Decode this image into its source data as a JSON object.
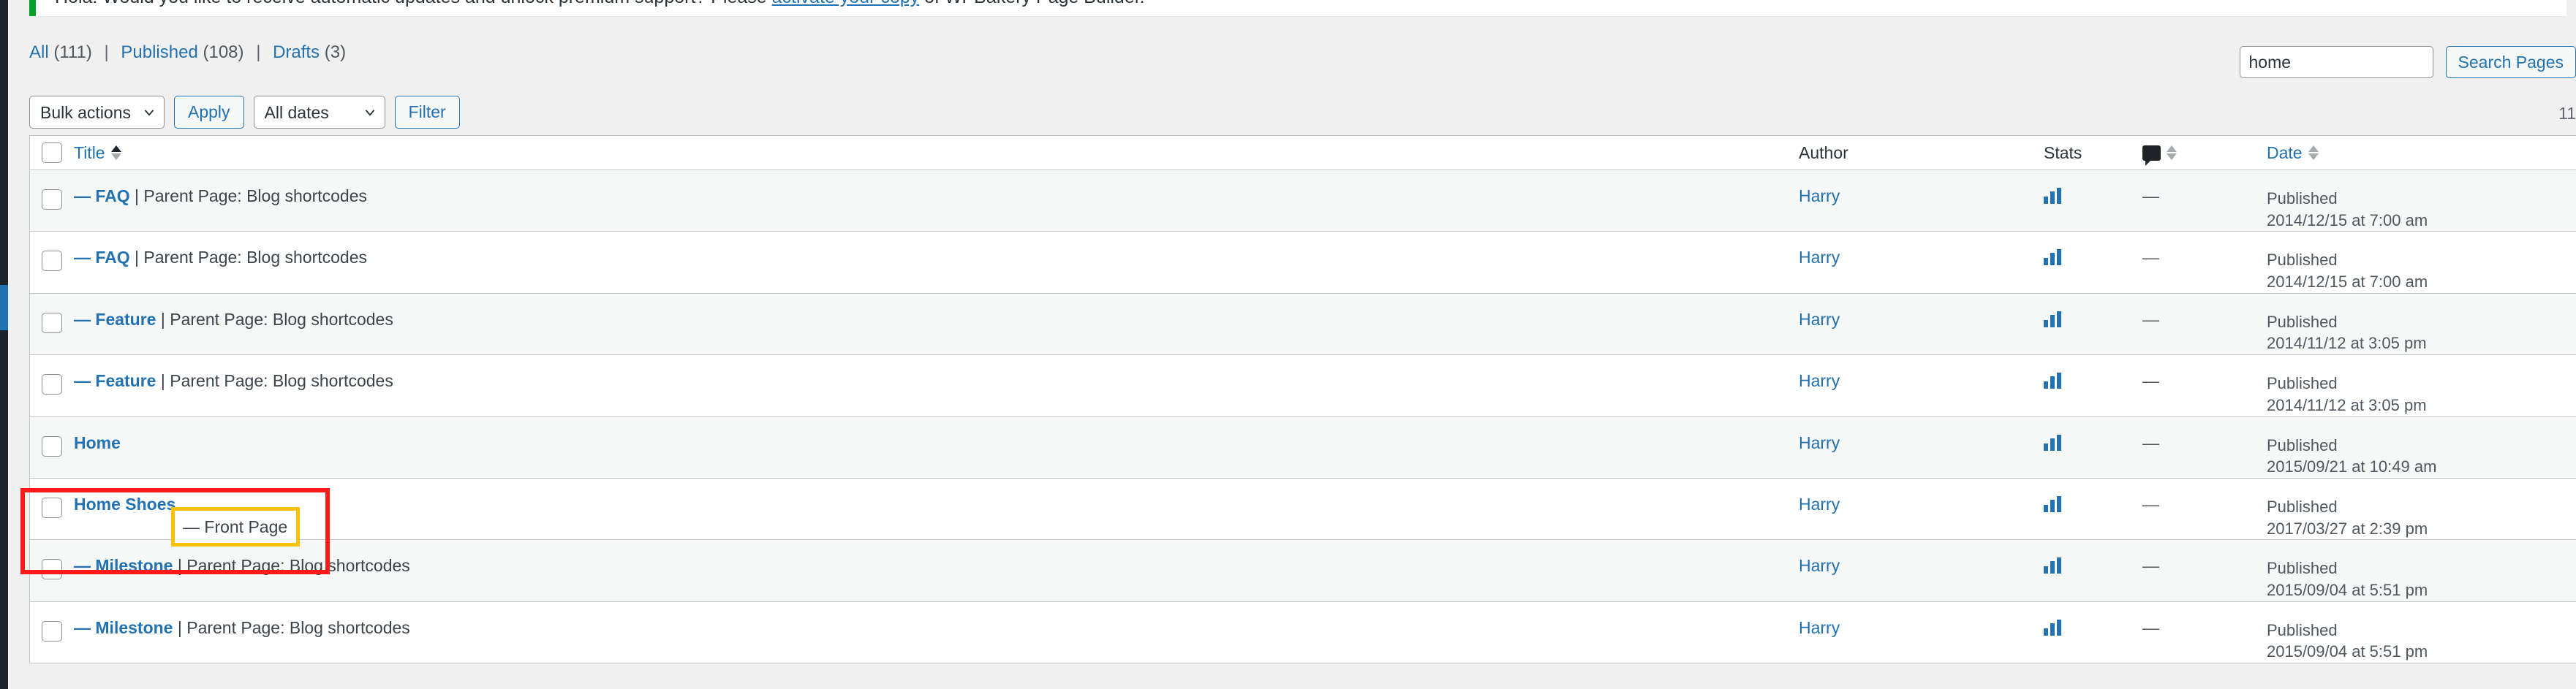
{
  "notice": {
    "text_before": "Hola! Would you like to receive automatic updates and unlock premium support? Please ",
    "link": "activate your copy",
    "text_after": " of WPBakery Page Builder."
  },
  "filters": {
    "all_label": "All",
    "all_count": "(111)",
    "published_label": "Published",
    "published_count": "(108)",
    "drafts_label": "Drafts",
    "drafts_count": "(3)",
    "separator": "|"
  },
  "search": {
    "value": "home",
    "placeholder": "",
    "button_label": "Search Pages"
  },
  "tablenav": {
    "bulk_actions_label": "Bulk actions",
    "apply_label": "Apply",
    "all_dates_label": "All dates",
    "filter_label": "Filter",
    "displaying_num": "11"
  },
  "table": {
    "headers": {
      "title": "Title",
      "author": "Author",
      "stats": "Stats",
      "comments_icon": "comment-bubble-icon",
      "date": "Date"
    },
    "rows": [
      {
        "title_link": "— FAQ",
        "title_meta": " | Parent Page: Blog shortcodes",
        "author": "Harry",
        "stats_icon": "bar-chart-icon",
        "comments": "—",
        "date_status": "Published",
        "date_value": "2014/12/15 at 7:00 am"
      },
      {
        "title_link": "— FAQ",
        "title_meta": " | Parent Page: Blog shortcodes",
        "author": "Harry",
        "stats_icon": "bar-chart-icon",
        "comments": "—",
        "date_status": "Published",
        "date_value": "2014/12/15 at 7:00 am"
      },
      {
        "title_link": "— Feature",
        "title_meta": " | Parent Page: Blog shortcodes",
        "author": "Harry",
        "stats_icon": "bar-chart-icon",
        "comments": "—",
        "date_status": "Published",
        "date_value": "2014/11/12 at 3:05 pm"
      },
      {
        "title_link": "— Feature",
        "title_meta": " | Parent Page: Blog shortcodes",
        "author": "Harry",
        "stats_icon": "bar-chart-icon",
        "comments": "—",
        "date_status": "Published",
        "date_value": "2014/11/12 at 3:05 pm"
      },
      {
        "title_link": "Home",
        "title_meta": "",
        "author": "Harry",
        "stats_icon": "bar-chart-icon",
        "comments": "—",
        "date_status": "Published",
        "date_value": "2015/09/21 at 10:49 am"
      },
      {
        "title_link": "Home Shoes",
        "title_meta": "",
        "author": "Harry",
        "stats_icon": "bar-chart-icon",
        "comments": "—",
        "date_status": "Published",
        "date_value": "2017/03/27 at 2:39 pm"
      },
      {
        "title_link": "— Milestone",
        "title_meta": " | Parent Page: Blog shortcodes",
        "author": "Harry",
        "stats_icon": "bar-chart-icon",
        "comments": "—",
        "date_status": "Published",
        "date_value": "2015/09/04 at 5:51 pm"
      },
      {
        "title_link": "— Milestone",
        "title_meta": " | Parent Page: Blog shortcodes",
        "author": "Harry",
        "stats_icon": "bar-chart-icon",
        "comments": "—",
        "date_status": "Published",
        "date_value": "2015/09/04 at 5:51 pm"
      }
    ]
  },
  "annotations": {
    "front_page_badge": "— Front Page"
  },
  "colors": {
    "link": "#2271b1",
    "notice_accent": "#00a32a",
    "annotation_red": "#ff1a1a",
    "annotation_yellow": "#ffc008",
    "admin_bg": "#1d2327"
  }
}
